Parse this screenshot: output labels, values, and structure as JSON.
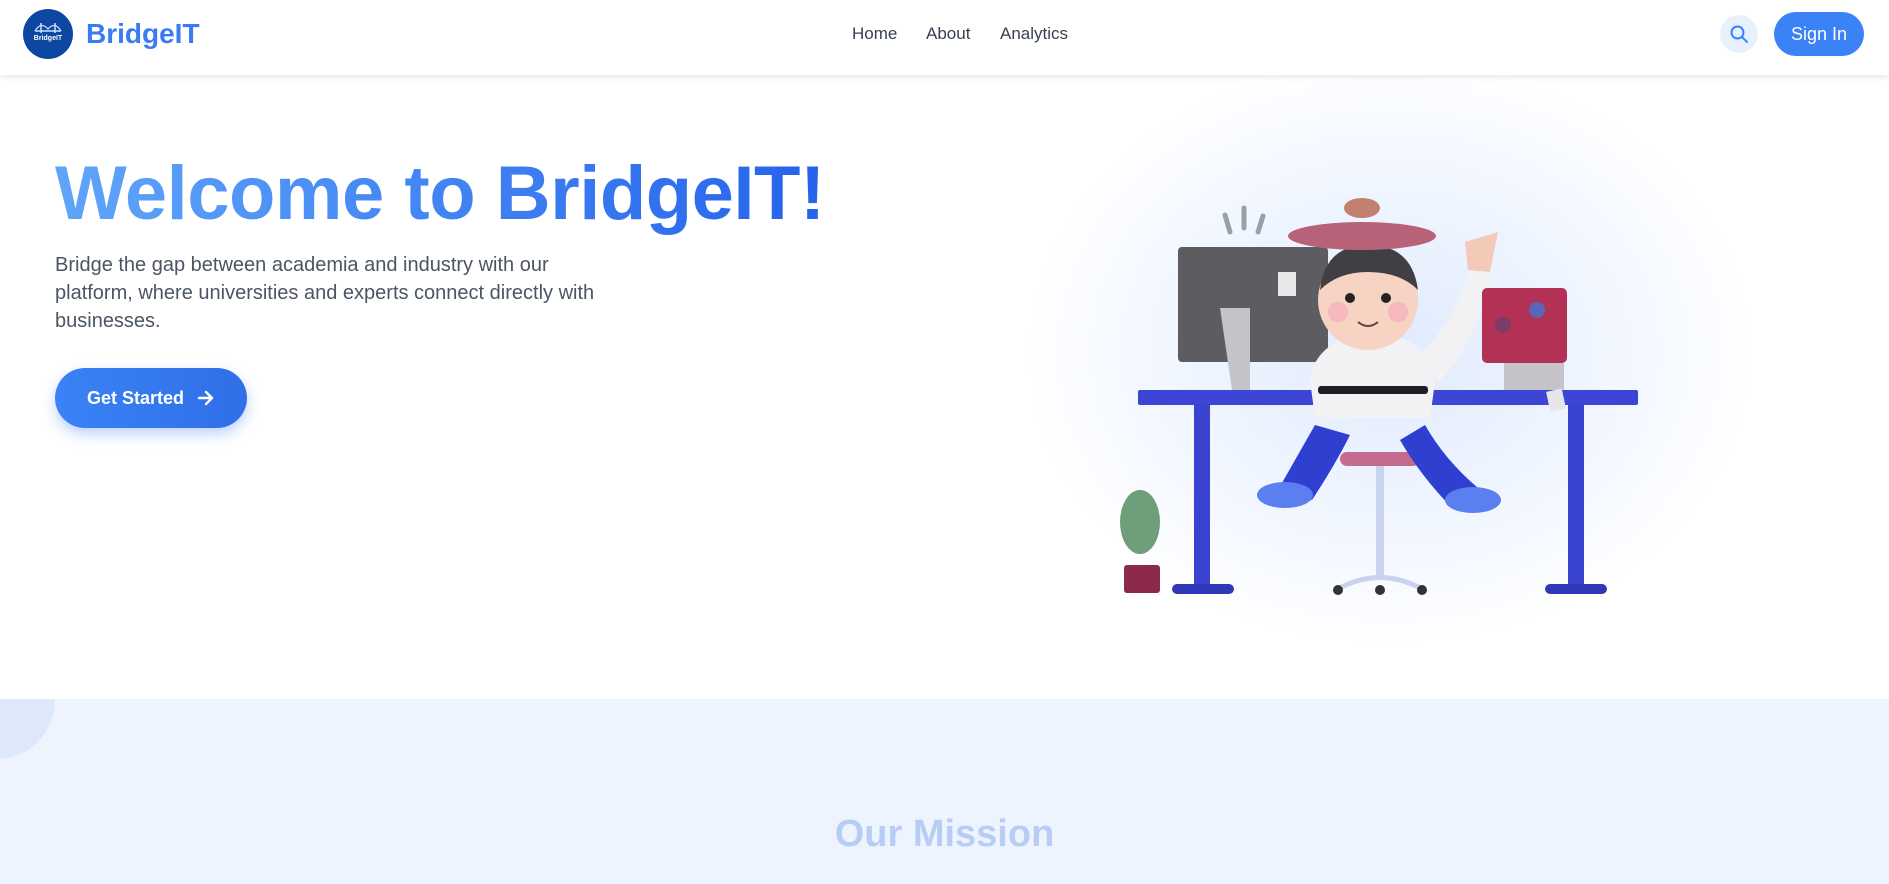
{
  "header": {
    "logo_text": "BridgeIT",
    "brand": "BridgeIT",
    "nav": {
      "home": "Home",
      "about": "About",
      "analytics": "Analytics"
    },
    "signin_label": "Sign In",
    "search_icon": "search-icon"
  },
  "hero": {
    "title": "Welcome to BridgeIT!",
    "subtitle": "Bridge the gap between academia and industry with our platform, where universities and experts connect directly with businesses.",
    "cta_label": "Get Started",
    "cta_icon": "arrow-right-icon"
  },
  "mission": {
    "title": "Our Mission"
  },
  "colors": {
    "primary": "#3b82f6",
    "brand_text": "#3b7bf0",
    "mission_bg": "#eef4fd",
    "title_gradient_start": "#60a5fa",
    "title_gradient_end": "#2563eb"
  }
}
